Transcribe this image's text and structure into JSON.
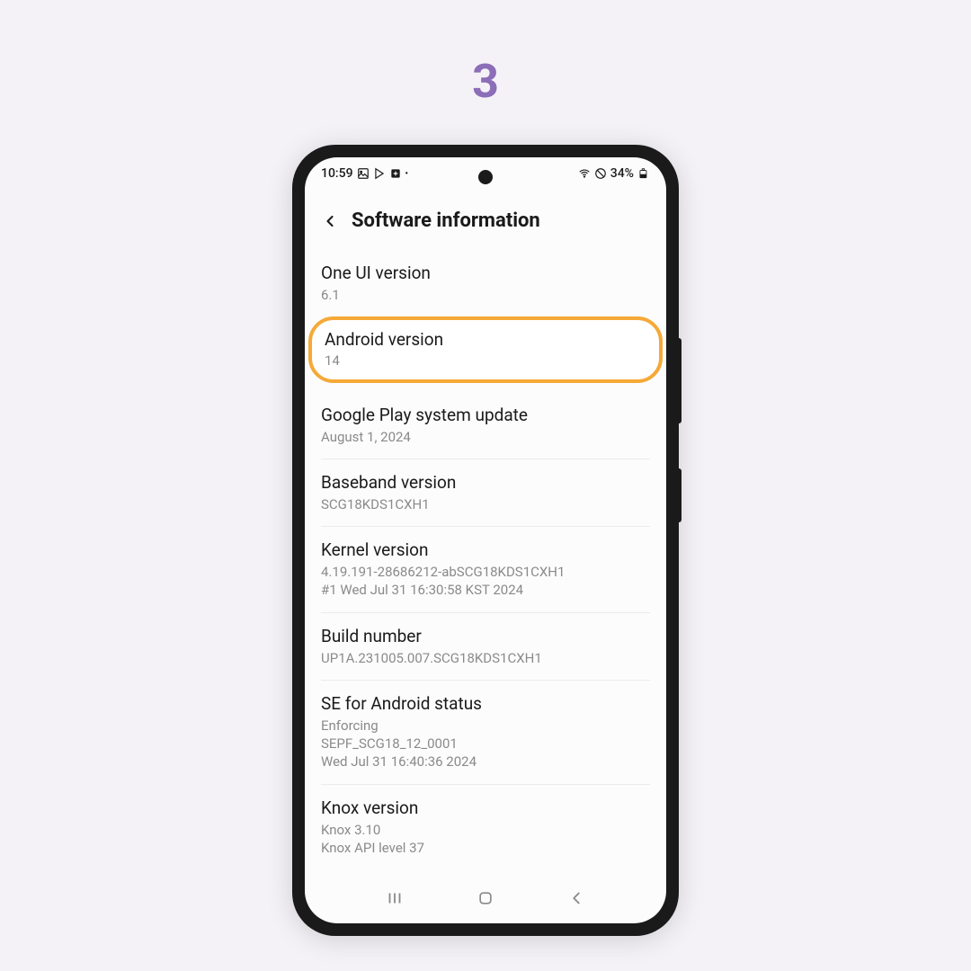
{
  "step": "3",
  "statusBar": {
    "time": "10:59",
    "battery": "34%"
  },
  "header": {
    "title": "Software information"
  },
  "items": {
    "oneUi": {
      "label": "One UI version",
      "value": "6.1"
    },
    "android": {
      "label": "Android version",
      "value": "14"
    },
    "googlePlay": {
      "label": "Google Play system update",
      "value": "August 1, 2024"
    },
    "baseband": {
      "label": "Baseband version",
      "value": "SCG18KDS1CXH1"
    },
    "kernel": {
      "label": "Kernel version",
      "line1": "4.19.191-28686212-abSCG18KDS1CXH1",
      "line2": "#1 Wed Jul 31 16:30:58 KST 2024"
    },
    "build": {
      "label": "Build number",
      "value": "UP1A.231005.007.SCG18KDS1CXH1"
    },
    "seAndroid": {
      "label": "SE for Android status",
      "line1": "Enforcing",
      "line2": "SEPF_SCG18_12_0001",
      "line3": "Wed Jul 31 16:40:36 2024"
    },
    "knox": {
      "label": "Knox version",
      "line1": "Knox 3.10",
      "line2": "Knox API level 37"
    }
  }
}
